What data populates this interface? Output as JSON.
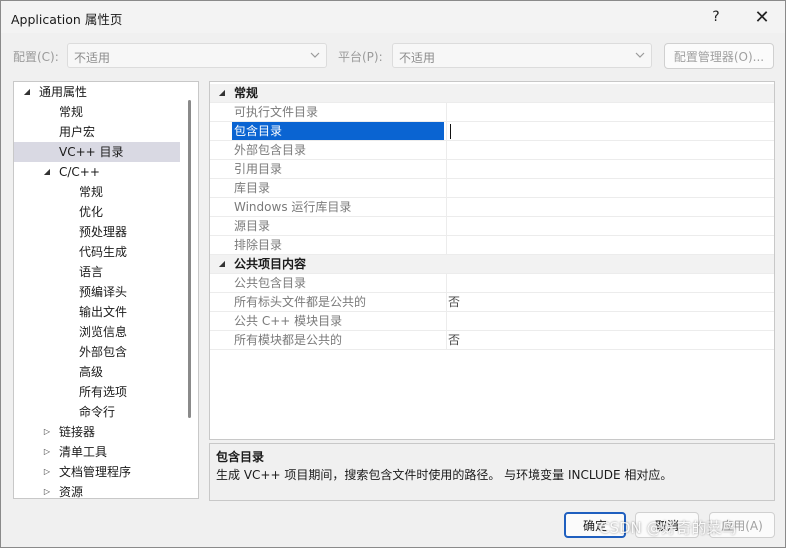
{
  "window": {
    "title": "Application 属性页",
    "help_glyph": "?",
    "close_glyph": "✕"
  },
  "config_bar": {
    "config_label": "配置(C):",
    "config_value": "不适用",
    "platform_label": "平台(P):",
    "platform_value": "不适用",
    "config_manager_label": "配置管理器(O)..."
  },
  "tree": [
    {
      "label": "通用属性",
      "depth": 0,
      "toggle": "expanded"
    },
    {
      "label": "常规",
      "depth": 1,
      "toggle": "none"
    },
    {
      "label": "用户宏",
      "depth": 1,
      "toggle": "none"
    },
    {
      "label": "VC++ 目录",
      "depth": 1,
      "toggle": "none",
      "selected": true
    },
    {
      "label": "C/C++",
      "depth": 1,
      "toggle": "expanded"
    },
    {
      "label": "常规",
      "depth": 2,
      "toggle": "none"
    },
    {
      "label": "优化",
      "depth": 2,
      "toggle": "none"
    },
    {
      "label": "预处理器",
      "depth": 2,
      "toggle": "none"
    },
    {
      "label": "代码生成",
      "depth": 2,
      "toggle": "none"
    },
    {
      "label": "语言",
      "depth": 2,
      "toggle": "none"
    },
    {
      "label": "预编译头",
      "depth": 2,
      "toggle": "none"
    },
    {
      "label": "输出文件",
      "depth": 2,
      "toggle": "none"
    },
    {
      "label": "浏览信息",
      "depth": 2,
      "toggle": "none"
    },
    {
      "label": "外部包含",
      "depth": 2,
      "toggle": "none"
    },
    {
      "label": "高级",
      "depth": 2,
      "toggle": "none"
    },
    {
      "label": "所有选项",
      "depth": 2,
      "toggle": "none"
    },
    {
      "label": "命令行",
      "depth": 2,
      "toggle": "none"
    },
    {
      "label": "链接器",
      "depth": 1,
      "toggle": "collapsed"
    },
    {
      "label": "清单工具",
      "depth": 1,
      "toggle": "collapsed"
    },
    {
      "label": "文档管理程序",
      "depth": 1,
      "toggle": "collapsed"
    },
    {
      "label": "资源",
      "depth": 1,
      "toggle": "collapsed"
    }
  ],
  "grid": [
    {
      "type": "category",
      "name": "常规"
    },
    {
      "type": "prop",
      "name": "可执行文件目录",
      "value": ""
    },
    {
      "type": "prop",
      "name": "包含目录",
      "value": "",
      "selected": true
    },
    {
      "type": "prop",
      "name": "外部包含目录",
      "value": ""
    },
    {
      "type": "prop",
      "name": "引用目录",
      "value": ""
    },
    {
      "type": "prop",
      "name": "库目录",
      "value": ""
    },
    {
      "type": "prop",
      "name": "Windows 运行库目录",
      "value": ""
    },
    {
      "type": "prop",
      "name": "源目录",
      "value": ""
    },
    {
      "type": "prop",
      "name": "排除目录",
      "value": ""
    },
    {
      "type": "category",
      "name": "公共项目内容"
    },
    {
      "type": "prop",
      "name": "公共包含目录",
      "value": ""
    },
    {
      "type": "prop",
      "name": "所有标头文件都是公共的",
      "value": "否"
    },
    {
      "type": "prop",
      "name": "公共 C++ 模块目录",
      "value": ""
    },
    {
      "type": "prop",
      "name": "所有模块都是公共的",
      "value": "否"
    }
  ],
  "description": {
    "title": "包含目录",
    "text": "生成 VC++ 项目期间，搜索包含文件时使用的路径。 与环境变量 INCLUDE 相对应。"
  },
  "footer": {
    "ok_label": "确定",
    "cancel_label": "取消",
    "apply_label": "应用(A)"
  },
  "watermark": "CSDN @好奇的菜鸟"
}
